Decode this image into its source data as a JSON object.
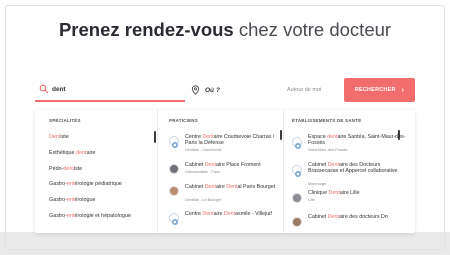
{
  "headline": {
    "bold": "Prenez rendez-vous",
    "light": "chez votre docteur"
  },
  "search": {
    "value": "dent",
    "where_label": "Où ?",
    "where_hint": "Autour de moi",
    "button_label": "RECHERCHER",
    "button_chevron": "›"
  },
  "dropdown": {
    "specialties": {
      "header": "SPÉCIALITÉS",
      "items": [
        {
          "before": "",
          "match": "Dent",
          "after": "iste"
        },
        {
          "before": "Esthétique ",
          "match": "dent",
          "after": "aire"
        },
        {
          "before": "Pédo-",
          "match": "dent",
          "after": "iste"
        },
        {
          "before": "Gastro-",
          "match": "ent",
          "after": "érologie pédiatrique"
        },
        {
          "before": "Gastro-",
          "match": "ent",
          "after": "érologue"
        },
        {
          "before": "Gastro-",
          "match": "ent",
          "after": "érologie et hépatologue"
        }
      ]
    },
    "practitioners": {
      "header": "PRATICIENS",
      "items": [
        {
          "parts": [
            {
              "t": "Centre "
            },
            {
              "t": "Dent",
              "h": true
            },
            {
              "t": "aire Courbevoie Charras / Paris la Défense"
            }
          ],
          "sub": "Dentiste - Courbevoie",
          "avatar": "logo"
        },
        {
          "parts": [
            {
              "t": "Cabinet "
            },
            {
              "t": "Dent",
              "h": true
            },
            {
              "t": "aire Place Froment"
            }
          ],
          "sub": "Orthodontiste - Paris",
          "avatar": "photo"
        },
        {
          "parts": [
            {
              "t": "Cabinet "
            },
            {
              "t": "Dent",
              "h": true
            },
            {
              "t": "aire "
            },
            {
              "t": "Dent",
              "h": true
            },
            {
              "t": "al Paris Bourget"
            }
          ],
          "sub": "Dentiste - Le Bourget",
          "avatar": "photo"
        },
        {
          "parts": [
            {
              "t": "Centre "
            },
            {
              "t": "Dent",
              "h": true
            },
            {
              "t": "aire "
            },
            {
              "t": "Dent",
              "h": true
            },
            {
              "t": "asmile - Villejuif"
            }
          ],
          "sub": "",
          "avatar": "logo"
        }
      ]
    },
    "establishments": {
      "header": "ÉTABLISSEMENTS DE SANTÉ",
      "items": [
        {
          "parts": [
            {
              "t": "Espace "
            },
            {
              "t": "dent",
              "h": true
            },
            {
              "t": "aire Santéa, Saint-Maur-des-Fossés"
            }
          ],
          "sub": "Saint-Maur-des-Fossés",
          "avatar": "logo"
        },
        {
          "parts": [
            {
              "t": "Cabinet "
            },
            {
              "t": "Dent",
              "h": true
            },
            {
              "t": "aire des Docteurs Brassecasse et Appercel collaborative"
            }
          ],
          "sub": "Montrouge",
          "avatar": "logo"
        },
        {
          "parts": [
            {
              "t": "Clinique "
            },
            {
              "t": "Dent",
              "h": true
            },
            {
              "t": "aire Lille"
            }
          ],
          "sub": "Lille",
          "avatar": "photo"
        },
        {
          "parts": [
            {
              "t": "Cabinet "
            },
            {
              "t": "Dent",
              "h": true
            },
            {
              "t": "aire des docteurs Do"
            }
          ],
          "sub": "",
          "avatar": "photo"
        }
      ]
    }
  },
  "colors": {
    "accent": "#f26b6b",
    "button": "#f26e6e",
    "text": "#2b2b33"
  }
}
